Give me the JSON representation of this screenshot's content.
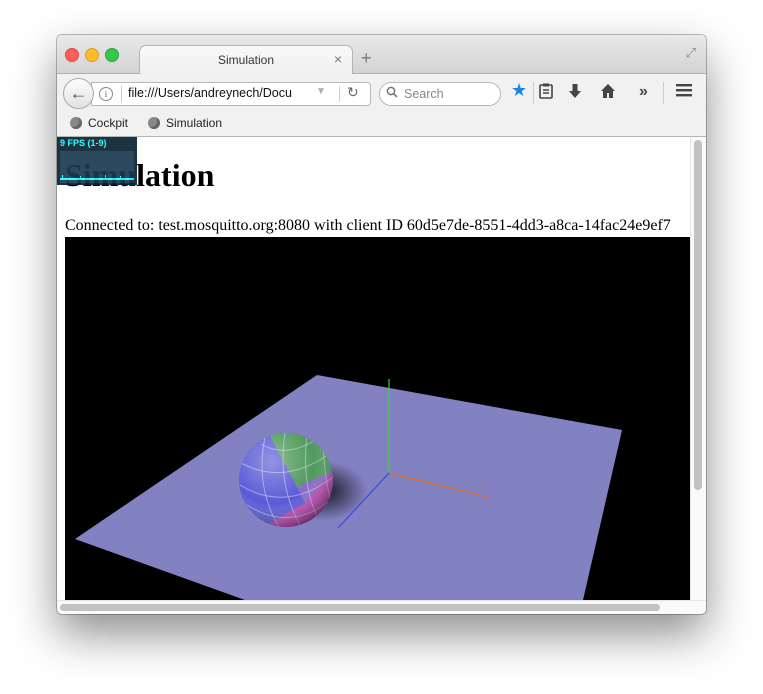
{
  "window": {
    "tab_title": "Simulation",
    "tab_close_glyph": "×",
    "new_tab_glyph": "+"
  },
  "toolbar": {
    "url": "file:///Users/andreynech/Docu",
    "search_placeholder": "Search"
  },
  "bookmarks": [
    {
      "label": "Cockpit"
    },
    {
      "label": "Simulation"
    }
  ],
  "page": {
    "title": "Simulation",
    "connection_text": "Connected to: test.mosquitto.org:8080 with client ID 60d5e7de-8551-4dd3-a8ca-14fac24e9ef7"
  },
  "fps_meter": {
    "label": "9 FPS (1-9)"
  },
  "colors": {
    "accent": "#1a86e8",
    "plane": "#7e7dc9",
    "axis_x": "#e06a2c",
    "axis_y": "#3cd23c",
    "axis_z": "#3a4ad8"
  },
  "icons": [
    "back-icon",
    "info-icon",
    "reload-icon",
    "search-icon",
    "bookmark-star-icon",
    "reading-list-icon",
    "download-icon",
    "home-icon",
    "overflow-icon",
    "menu-icon",
    "globe-icon"
  ]
}
